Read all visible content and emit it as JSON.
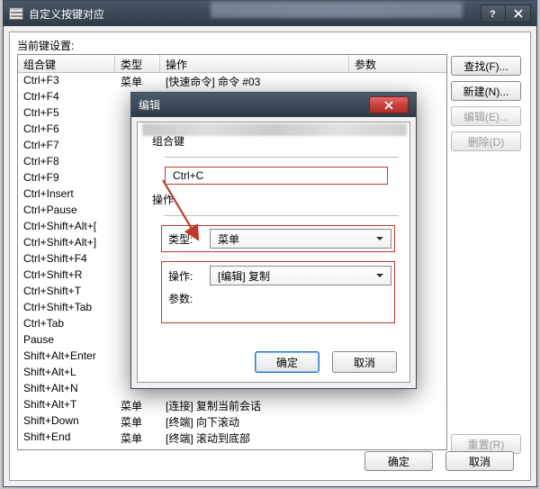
{
  "outer": {
    "title": "自定义按键对应",
    "section_label": "当前键设置:",
    "columns": {
      "c1": "组合键",
      "c2": "类型",
      "c3": "操作",
      "c4": "参数"
    },
    "rows": [
      {
        "c1": "Ctrl+F3",
        "c2": "菜单",
        "c3": "[快速命令] 命令 #03",
        "c4": ""
      },
      {
        "c1": "Ctrl+F4",
        "c2": "",
        "c3": "",
        "c4": ""
      },
      {
        "c1": "Ctrl+F5",
        "c2": "",
        "c3": "",
        "c4": ""
      },
      {
        "c1": "Ctrl+F6",
        "c2": "",
        "c3": "",
        "c4": ""
      },
      {
        "c1": "Ctrl+F7",
        "c2": "",
        "c3": "",
        "c4": ""
      },
      {
        "c1": "Ctrl+F8",
        "c2": "",
        "c3": "",
        "c4": ""
      },
      {
        "c1": "Ctrl+F9",
        "c2": "",
        "c3": "",
        "c4": ""
      },
      {
        "c1": "Ctrl+Insert",
        "c2": "",
        "c3": "",
        "c4": ""
      },
      {
        "c1": "Ctrl+Pause",
        "c2": "",
        "c3": "",
        "c4": ""
      },
      {
        "c1": "Ctrl+Shift+Alt+[",
        "c2": "",
        "c3": "",
        "c4": ""
      },
      {
        "c1": "Ctrl+Shift+Alt+]",
        "c2": "",
        "c3": "",
        "c4": ""
      },
      {
        "c1": "Ctrl+Shift+F4",
        "c2": "",
        "c3": "",
        "c4": ""
      },
      {
        "c1": "Ctrl+Shift+R",
        "c2": "",
        "c3": "",
        "c4": ""
      },
      {
        "c1": "Ctrl+Shift+T",
        "c2": "",
        "c3": "",
        "c4": ""
      },
      {
        "c1": "Ctrl+Shift+Tab",
        "c2": "",
        "c3": "",
        "c4": ""
      },
      {
        "c1": "Ctrl+Tab",
        "c2": "",
        "c3": "",
        "c4": ""
      },
      {
        "c1": "Pause",
        "c2": "",
        "c3": "",
        "c4": ""
      },
      {
        "c1": "Shift+Alt+Enter",
        "c2": "",
        "c3": "",
        "c4": ""
      },
      {
        "c1": "Shift+Alt+L",
        "c2": "",
        "c3": "",
        "c4": ""
      },
      {
        "c1": "Shift+Alt+N",
        "c2": "",
        "c3": "",
        "c4": ""
      },
      {
        "c1": "Shift+Alt+T",
        "c2": "菜单",
        "c3": "[连接] 复制当前会话",
        "c4": ""
      },
      {
        "c1": "Shift+Down",
        "c2": "菜单",
        "c3": "[终端] 向下滚动",
        "c4": ""
      },
      {
        "c1": "Shift+End",
        "c2": "菜单",
        "c3": "[终端] 滚动到底部",
        "c4": ""
      }
    ],
    "side_buttons": {
      "find": "查找(F)...",
      "new": "新建(N)...",
      "edit": "编辑(E)...",
      "delete": "删除(D)",
      "reset": "重置(R)"
    },
    "ok": "确定",
    "cancel": "取消"
  },
  "dialog": {
    "title": "编辑",
    "group": {
      "combo_label": "组合键",
      "key_value": "Ctrl+C",
      "operation_label": "操作",
      "type_label": "类型:",
      "type_value": "菜单",
      "op_label": "操作:",
      "op_value": "[编辑] 复制",
      "param_label": "参数:"
    },
    "ok": "确定",
    "cancel": "取消"
  }
}
